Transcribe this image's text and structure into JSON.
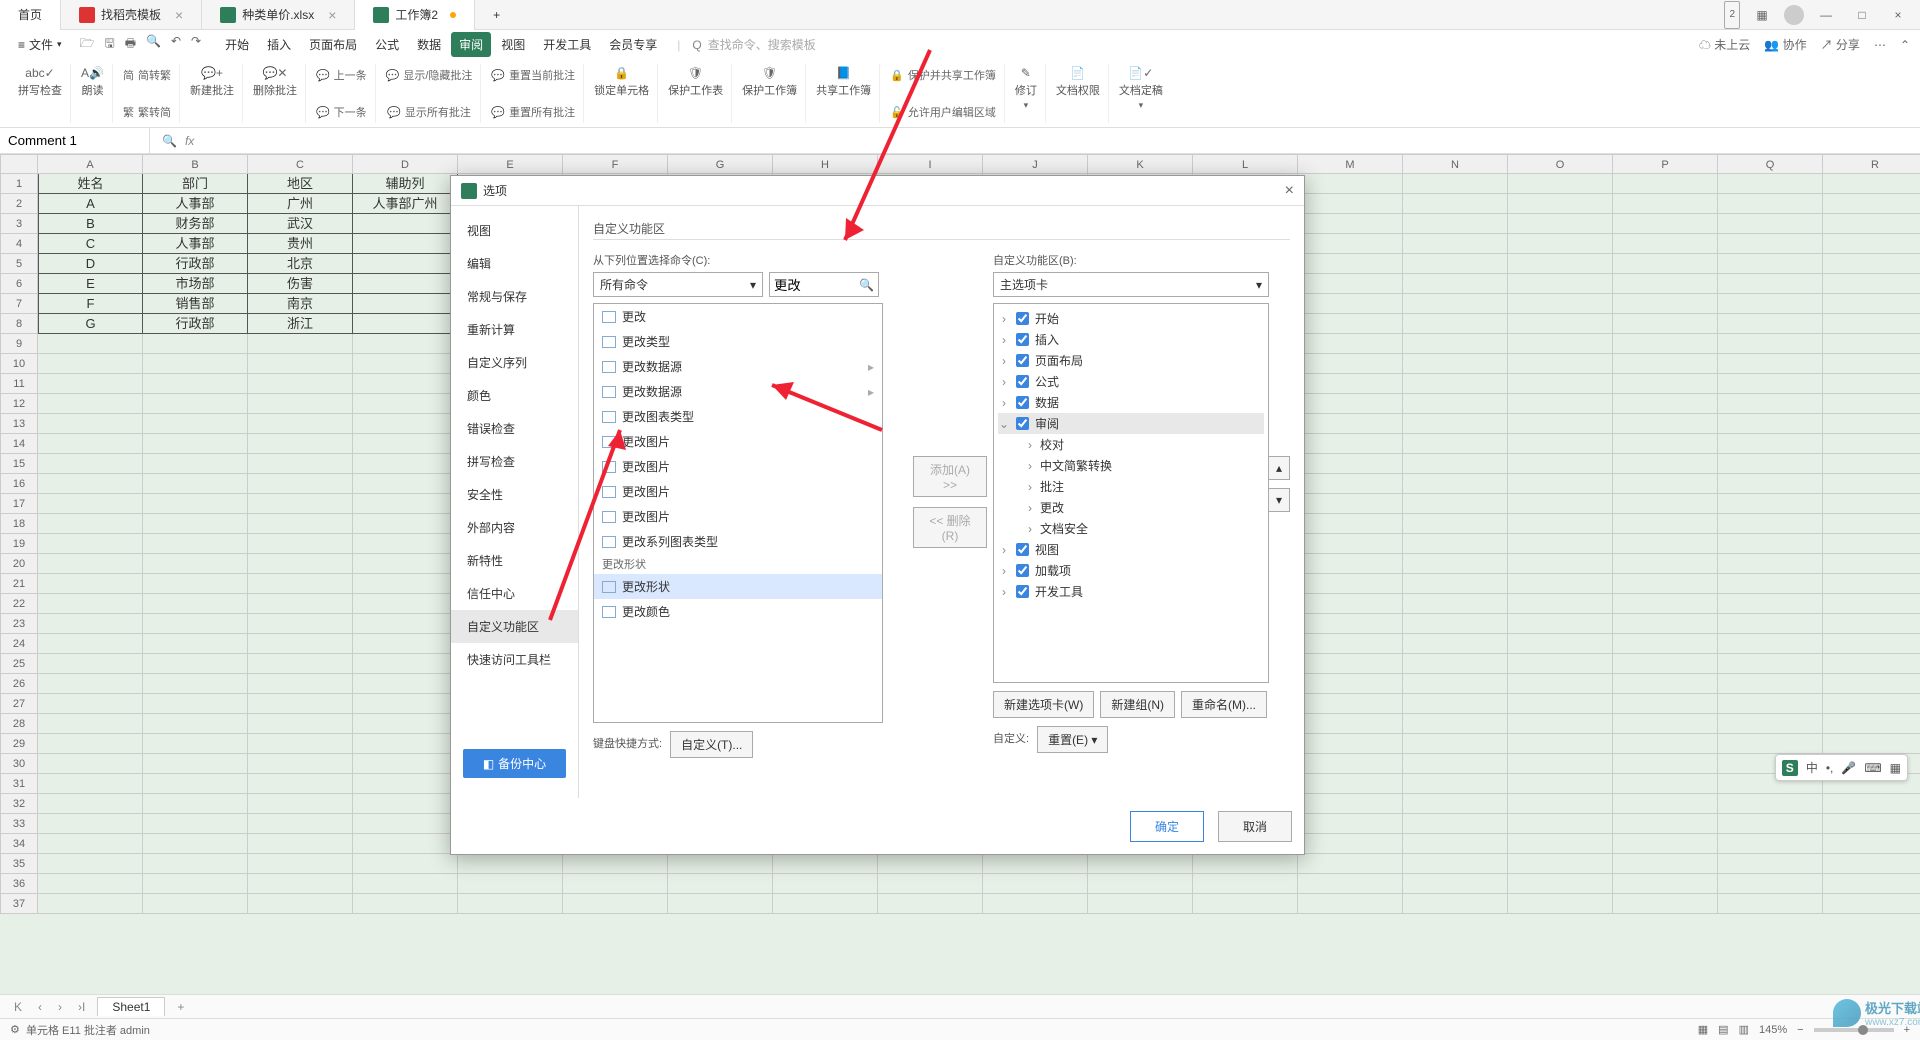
{
  "tabs": {
    "home": "首页",
    "t1": "找稻壳模板",
    "t2": "种类单价.xlsx",
    "t3": "工作簿2"
  },
  "window": {
    "counter": "2"
  },
  "menu": {
    "file": "文件",
    "items": [
      "开始",
      "插入",
      "页面布局",
      "公式",
      "数据",
      "审阅",
      "视图",
      "开发工具",
      "会员专享"
    ],
    "active_index": 5,
    "search_placeholder": "查找命令、搜索模板",
    "cloud": "未上云",
    "coop": "协作",
    "share": "分享"
  },
  "ribbon": {
    "g1a": "拼写检查",
    "g1b": "朗读",
    "g1c": "简转繁",
    "g1d": "繁转简",
    "g2a": "新建批注",
    "g2b": "删除批注",
    "g2c": "上一条",
    "g2d": "下一条",
    "g2e": "显示/隐藏批注",
    "g2f": "显示所有批注",
    "g2g": "重置当前批注",
    "g2h": "重置所有批注",
    "g3a": "锁定单元格",
    "g3b": "保护工作表",
    "g3c": "保护工作簿",
    "g3d": "共享工作簿",
    "g3e": "保护并共享工作簿",
    "g3f": "允许用户编辑区域",
    "g3g": "修订",
    "g4a": "文档权限",
    "g4b": "文档定稿"
  },
  "formula": {
    "name": "Comment 1"
  },
  "cols": [
    "A",
    "B",
    "C",
    "D",
    "E",
    "F",
    "G",
    "H",
    "I",
    "J",
    "K",
    "L",
    "M",
    "N",
    "O",
    "P",
    "Q",
    "R"
  ],
  "rowcount": 37,
  "table": {
    "head": [
      "姓名",
      "部门",
      "地区",
      "辅助列"
    ],
    "rows": [
      [
        "A",
        "人事部",
        "广州",
        "人事部广州"
      ],
      [
        "B",
        "财务部",
        "武汉",
        ""
      ],
      [
        "C",
        "人事部",
        "贵州",
        ""
      ],
      [
        "D",
        "行政部",
        "北京",
        ""
      ],
      [
        "E",
        "市场部",
        "伤害",
        ""
      ],
      [
        "F",
        "销售部",
        "南京",
        ""
      ],
      [
        "G",
        "行政部",
        "浙江",
        ""
      ]
    ]
  },
  "sheet": {
    "name": "Sheet1"
  },
  "status": {
    "cell": "单元格 E11 批注者 admin",
    "zoom": "145%"
  },
  "dialog": {
    "title": "选项",
    "side": [
      "视图",
      "编辑",
      "常规与保存",
      "重新计算",
      "自定义序列",
      "颜色",
      "错误检查",
      "拼写检查",
      "安全性",
      "外部内容",
      "新特性",
      "信任中心",
      "自定义功能区",
      "快速访问工具栏"
    ],
    "side_sel": 12,
    "backup": "备份中心",
    "section": "自定义功能区",
    "from_label": "从下列位置选择命令(C):",
    "from_value": "所有命令",
    "search_value": "更改",
    "commands_group1": [
      "更改",
      "更改类型",
      "更改数据源",
      "更改数据源",
      "更改图表类型",
      "更改图片",
      "更改图片",
      "更改图片",
      "更改图片",
      "更改系列图表类型"
    ],
    "group1_label": "更改形状",
    "commands_group2": [
      "更改形状",
      "更改颜色"
    ],
    "hover_index": 0,
    "to_label": "自定义功能区(B):",
    "to_value": "主选项卡",
    "tree": [
      {
        "exp": "›",
        "chk": true,
        "label": "开始"
      },
      {
        "exp": "›",
        "chk": true,
        "label": "插入"
      },
      {
        "exp": "›",
        "chk": true,
        "label": "页面布局"
      },
      {
        "exp": "›",
        "chk": true,
        "label": "公式"
      },
      {
        "exp": "›",
        "chk": true,
        "label": "数据"
      },
      {
        "exp": "⌄",
        "chk": true,
        "label": "审阅",
        "sel": true
      },
      {
        "child": true,
        "exp": "›",
        "label": "校对"
      },
      {
        "child": true,
        "exp": "›",
        "label": "中文简繁转换"
      },
      {
        "child": true,
        "exp": "›",
        "label": "批注"
      },
      {
        "child": true,
        "exp": "›",
        "label": "更改"
      },
      {
        "child": true,
        "exp": "›",
        "label": "文档安全"
      },
      {
        "exp": "›",
        "chk": true,
        "label": "视图"
      },
      {
        "exp": "›",
        "chk": true,
        "label": "加载项"
      },
      {
        "exp": "›",
        "chk": true,
        "label": "开发工具"
      }
    ],
    "add": "添加(A) >>",
    "del": "<< 删除(R)",
    "newtab": "新建选项卡(W)",
    "newgrp": "新建组(N)",
    "rename": "重命名(M)...",
    "kb_label": "键盘快捷方式:",
    "kb_btn": "自定义(T)...",
    "reset_label": "自定义:",
    "reset_btn": "重置(E)",
    "ok": "确定",
    "cancel": "取消"
  },
  "ime": {
    "s": "S",
    "zh": "中"
  }
}
